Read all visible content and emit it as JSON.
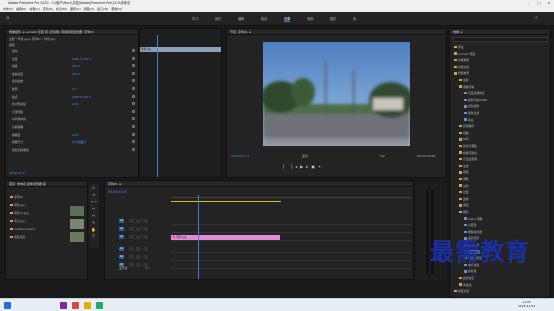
{
  "window": {
    "title": "Adobe Premiere Pro 2020 - C:\\用户\\Mary\\文档\\Adobe\\Premiere Pro\\14.0\\未命名"
  },
  "menu": [
    "文件(F)",
    "编辑(E)",
    "剪辑(C)",
    "序列(S)",
    "标记(M)",
    "图形(G)",
    "视图(V)",
    "窗口(W)",
    "帮助(H)"
  ],
  "workspaces": [
    {
      "label": "学习",
      "active": false
    },
    {
      "label": "组件",
      "active": false
    },
    {
      "label": "编辑",
      "active": false
    },
    {
      "label": "颜色",
      "active": false
    },
    {
      "label": "效果",
      "active": true
    },
    {
      "label": "音频",
      "active": false
    },
    {
      "label": "图形",
      "active": false
    },
    {
      "label": "库",
      "active": false
    }
  ],
  "effect_controls": {
    "tabs": "效果控件 ≡   Lumetri 范围   源:(无剪辑)   音频剪辑混合器: 序列01",
    "source": "主要 * 风景.jpg  ▸  序列01 * 风景.jpg",
    "section_video": "视频",
    "rows": [
      {
        "label": "运动",
        "value": ""
      },
      {
        "label": "位置",
        "value": "1280.0   720.0"
      },
      {
        "label": "缩放",
        "value": "100.0"
      },
      {
        "label": "缩放宽度",
        "value": "100.0"
      },
      {
        "label": "等比缩放",
        "value": ""
      },
      {
        "label": "旋转",
        "value": "0.0"
      },
      {
        "label": "锚点",
        "value": "1280.0   720.0"
      },
      {
        "label": "防闪烁滤镜",
        "value": "0.00"
      },
      {
        "label": "不透明度",
        "value": ""
      },
      {
        "label": "时间重映射",
        "value": ""
      },
      {
        "label": "高斯模糊",
        "value": ""
      },
      {
        "label": "模糊度",
        "value": "20.0"
      },
      {
        "label": "模糊尺寸",
        "value": "水平和垂直"
      },
      {
        "label": "重复边缘像素",
        "value": ""
      }
    ],
    "timecode": "00:00:01:07"
  },
  "program": {
    "tab": "节目: 序列01 ≡",
    "timecode_left": "00:00:01:07",
    "zoom": "适合",
    "quality": "1/2",
    "timecode_right": "00:00:05:00"
  },
  "project": {
    "tabs": "项目: 未命名   媒体浏览器   库",
    "items": [
      {
        "name": "序列01",
        "icon": "sequence-icon"
      },
      {
        "name": "风景.jpg",
        "icon": "image-icon"
      },
      {
        "name": "风景(2).jpg",
        "icon": "image-icon"
      },
      {
        "name": "天空.jpg",
        "icon": "image-icon"
      },
      {
        "name": "Creative Cloud",
        "icon": "folder-icon"
      },
      {
        "name": "团队项目",
        "icon": "folder-icon"
      }
    ]
  },
  "timeline": {
    "tab": "序列01 ≡",
    "timecode": "00:00:01:07",
    "tracks": [
      "V3",
      "V2",
      "V1",
      "A1",
      "A2",
      "A3"
    ],
    "master": "主声道",
    "master_value": "0.0",
    "clip": "fx 风景.jpg"
  },
  "effects": {
    "tab": "效果 ≡",
    "items": [
      {
        "label": "预设",
        "level": 0,
        "sel": false
      },
      {
        "label": "Lumetri 预设",
        "level": 0,
        "sel": false
      },
      {
        "label": "音频效果",
        "level": 0,
        "sel": false
      },
      {
        "label": "音频过渡",
        "level": 0,
        "sel": false
      },
      {
        "label": "视频效果",
        "level": 0,
        "sel": false
      },
      {
        "label": "变换",
        "level": 1,
        "sel": false
      },
      {
        "label": "图像控制",
        "level": 1,
        "sel": false
      },
      {
        "label": "灰度系数校正",
        "level": 2,
        "sel": false
      },
      {
        "label": "颜色平衡(RGB)",
        "level": 2,
        "sel": false
      },
      {
        "label": "颜色替换",
        "level": 2,
        "sel": false
      },
      {
        "label": "颜色过滤",
        "level": 2,
        "sel": false
      },
      {
        "label": "黑白",
        "level": 2,
        "sel": false
      },
      {
        "label": "实用程序",
        "level": 1,
        "sel": false
      },
      {
        "label": "扭曲",
        "level": 1,
        "sel": false
      },
      {
        "label": "时间",
        "level": 1,
        "sel": false
      },
      {
        "label": "杂色与颗粒",
        "level": 1,
        "sel": false
      },
      {
        "label": "模糊与锐化",
        "level": 1,
        "sel": false
      },
      {
        "label": "沉浸式视频",
        "level": 1,
        "sel": false
      },
      {
        "label": "生成",
        "level": 1,
        "sel": false
      },
      {
        "label": "视频",
        "level": 1,
        "sel": false
      },
      {
        "label": "调整",
        "level": 1,
        "sel": false
      },
      {
        "label": "过时",
        "level": 1,
        "sel": false
      },
      {
        "label": "过渡",
        "level": 1,
        "sel": false
      },
      {
        "label": "透视",
        "level": 1,
        "sel": false
      },
      {
        "label": "通道",
        "level": 1,
        "sel": false
      },
      {
        "label": "键控",
        "level": 1,
        "sel": false
      },
      {
        "label": "Alpha 调整",
        "level": 2,
        "sel": false
      },
      {
        "label": "亮度键",
        "level": 2,
        "sel": false
      },
      {
        "label": "图像遮罩键",
        "level": 2,
        "sel": false
      },
      {
        "label": "差值遮罩",
        "level": 2,
        "sel": false
      },
      {
        "label": "移除遮罩",
        "level": 2,
        "sel": false
      },
      {
        "label": "超级键",
        "level": 2,
        "sel": true
      },
      {
        "label": "轨道遮罩键",
        "level": 2,
        "sel": false
      },
      {
        "label": "非红色键",
        "level": 2,
        "sel": false
      },
      {
        "label": "颜色键",
        "level": 2,
        "sel": false
      },
      {
        "label": "颜色校正",
        "level": 1,
        "sel": false
      },
      {
        "label": "风格化",
        "level": 1,
        "sel": false
      },
      {
        "label": "视频过渡",
        "level": 0,
        "sel": false
      }
    ]
  },
  "watermark": "最需教育",
  "clock": {
    "time": "11:01",
    "date": "2021/11/12"
  },
  "colors": {
    "accent": "#3a7fd1",
    "clip": "#e08ad8",
    "timecode": "#4f8ff0",
    "watermark": "#1a2fa0"
  }
}
